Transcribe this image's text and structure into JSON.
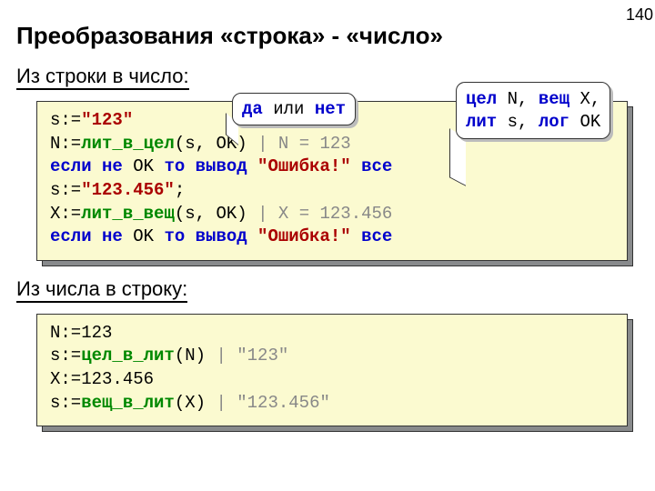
{
  "page_number": "140",
  "title": "Преобразования «строка» - «число»",
  "section1": {
    "heading": "Из строки в число:",
    "lines": {
      "l1a": "s:=",
      "l1b": "\"123\"",
      "l2a": "N:=",
      "l2b": "лит_в_цел",
      "l2c": "(s,",
      "l2d": " OK",
      "l2e": ") ",
      "l2f": "| N = 123",
      "l3a": "если не",
      "l3b": " OK ",
      "l3c": "то вывод",
      "l3d": " \"Ошибка!\" ",
      "l3e": "все",
      "l4a": "s:=",
      "l4b": "\"123.456\"",
      "l4c": ";",
      "l5a": "X:=",
      "l5b": "лит_в_вещ",
      "l5c": "(s,",
      "l5d": " OK",
      "l5e": ") ",
      "l5f": "| X = 123.456",
      "l6a": "если не",
      "l6b": " OK ",
      "l6c": "то вывод",
      "l6d": " \"Ошибка!\" ",
      "l6e": "все"
    }
  },
  "section2": {
    "heading": "Из числа в строку:",
    "lines": {
      "l1a": "N:=",
      "l1b": "123",
      "l2a": "s:=",
      "l2b": "цел_в_лит",
      "l2c": "(N) ",
      "l2d": "| \"123\"",
      "l3a": "X:=",
      "l3b": "123.456",
      "l4a": "s:=",
      "l4b": "вещ_в_лит",
      "l4c": "(X) ",
      "l4d": "| \"123.456\""
    }
  },
  "bubble1": {
    "kw": "да",
    "mid": " или ",
    "kw2": "нет"
  },
  "bubble2": {
    "w1": "цел",
    "v1": " N, ",
    "w2": "вещ",
    "v2": " X,",
    "w3": "лит",
    "v3": " s, ",
    "w4": "лог",
    "v4": " OK"
  }
}
